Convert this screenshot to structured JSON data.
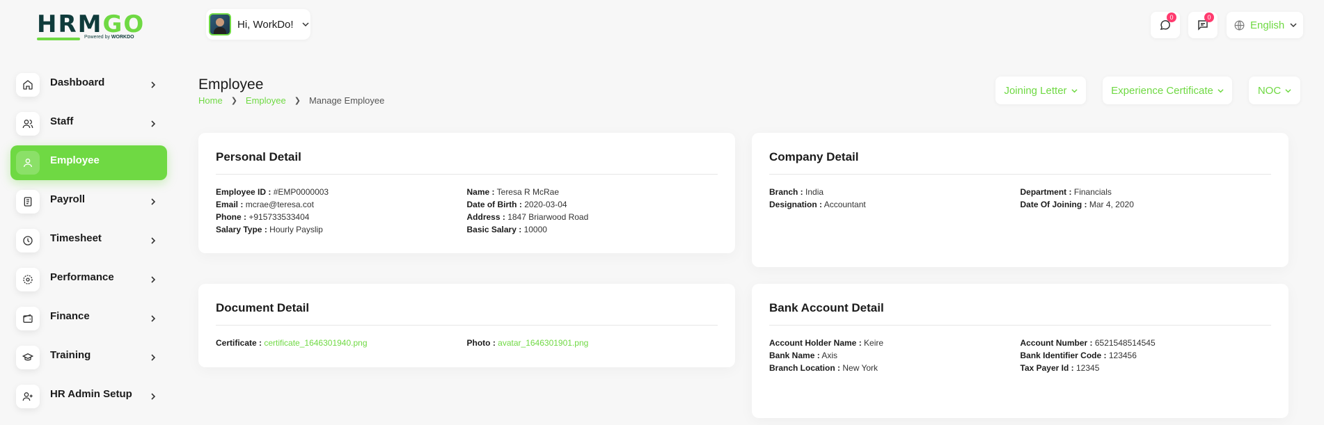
{
  "brand": {
    "logo_main": "HRM",
    "logo_go": "GO",
    "powered_by": "Powered by",
    "powered_brand": "WORKDO"
  },
  "sidebar": {
    "items": [
      {
        "label": "Dashboard",
        "icon": "home-icon"
      },
      {
        "label": "Staff",
        "icon": "users-icon"
      },
      {
        "label": "Employee",
        "icon": "user-icon",
        "active": true
      },
      {
        "label": "Payroll",
        "icon": "receipt-icon"
      },
      {
        "label": "Timesheet",
        "icon": "clock-icon"
      },
      {
        "label": "Performance",
        "icon": "performance-icon"
      },
      {
        "label": "Finance",
        "icon": "wallet-icon"
      },
      {
        "label": "Training",
        "icon": "graduation-cap-icon"
      },
      {
        "label": "HR Admin Setup",
        "icon": "user-plus-icon"
      }
    ]
  },
  "header": {
    "greeting": "Hi, WorkDo!",
    "messages_badge": "0",
    "notifications_badge": "0",
    "language": "English"
  },
  "page": {
    "title": "Employee",
    "breadcrumb": [
      "Home",
      "Employee",
      "Manage Employee"
    ],
    "actions": [
      "Joining Letter",
      "Experience Certificate",
      "NOC"
    ]
  },
  "personal": {
    "title": "Personal Detail",
    "left": [
      {
        "k": "Employee ID :",
        "v": "#EMP0000003"
      },
      {
        "k": "Email :",
        "v": "mcrae@teresa.cot"
      },
      {
        "k": "Phone :",
        "v": "+915733533404"
      },
      {
        "k": "Salary Type :",
        "v": "Hourly Payslip"
      }
    ],
    "right": [
      {
        "k": "Name :",
        "v": "Teresa R McRae"
      },
      {
        "k": "Date of Birth :",
        "v": "2020-03-04"
      },
      {
        "k": "Address :",
        "v": "1847  Briarwood Road"
      },
      {
        "k": "Basic Salary :",
        "v": "10000"
      }
    ]
  },
  "company": {
    "title": "Company Detail",
    "left": [
      {
        "k": "Branch :",
        "v": "India"
      },
      {
        "k": "Designation :",
        "v": "Accountant"
      }
    ],
    "right": [
      {
        "k": "Department :",
        "v": "Financials"
      },
      {
        "k": "Date Of Joining :",
        "v": "Mar 4, 2020"
      }
    ]
  },
  "document": {
    "title": "Document Detail",
    "left": [
      {
        "k": "Certificate :",
        "v": "certificate_1646301940.png"
      }
    ],
    "right": [
      {
        "k": "Photo :",
        "v": "avatar_1646301901.png"
      }
    ]
  },
  "bank": {
    "title": "Bank Account Detail",
    "left": [
      {
        "k": "Account Holder Name :",
        "v": "Keire"
      },
      {
        "k": "Bank Name :",
        "v": "Axis"
      },
      {
        "k": "Branch Location :",
        "v": "New York"
      }
    ],
    "right": [
      {
        "k": "Account Number :",
        "v": "6521548514545"
      },
      {
        "k": "Bank Identifier Code :",
        "v": "123456"
      },
      {
        "k": "Tax Payer Id :",
        "v": "12345"
      }
    ]
  },
  "colors": {
    "accent": "#6fd943",
    "badge": "#ff3a6e",
    "brand_dark": "#0f3b3b"
  }
}
